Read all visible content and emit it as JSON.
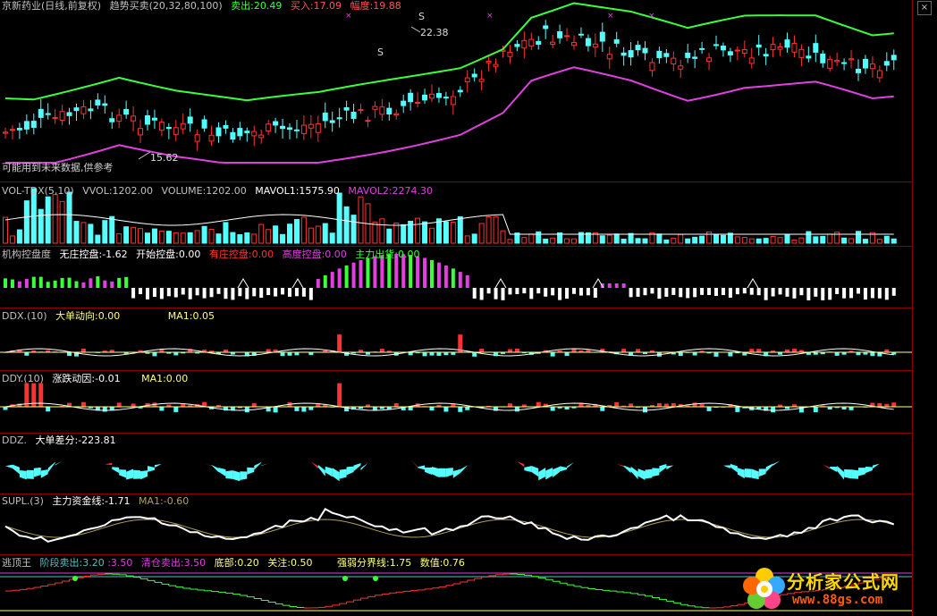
{
  "main": {
    "title": "京新药业(日线,前复权)",
    "indicator": "趋势买卖(20,32,80,100)",
    "sell_label": "卖出:20.49",
    "buy_label": "买入:17.09",
    "range_label": "幅度:19.88",
    "high_note": "22.38",
    "low_note": "15.62",
    "signal_s": "S",
    "warning": "可能用到未来数据,供参考",
    "colors": {
      "up": "#ff3232",
      "down": "#54ffff",
      "upper": "#3cff3c",
      "lower": "#e040e0"
    }
  },
  "vol": {
    "name": "VOL-TDX(5,10)",
    "vvol": "VVOL:1202.00",
    "volume": "VOLUME:1202.00",
    "mavol1": "MAVOL1:1575.90",
    "mavol2": "MAVOL2:2274.30"
  },
  "jgkpd": {
    "name": "机构控盘度",
    "a": "无庄控盘:-1.62",
    "b": "开始控盘:0.00",
    "c": "有庄控盘:0.00",
    "d": "高度控盘:0.00",
    "e": "主力出货:0.00"
  },
  "ddx": {
    "name": "DDX.(10)",
    "a": "大单动向:0.00",
    "b": "MA1:0.05"
  },
  "ddy": {
    "name": "DDY.(10)",
    "a": "涨跌动因:-0.01",
    "b": "MA1:0.00"
  },
  "ddz": {
    "name": "DDZ.",
    "a": "大单差分:-223.81"
  },
  "supl": {
    "name": "SUPL.(3)",
    "a": "主力资金线:-1.71",
    "b": "MA1:-0.60"
  },
  "tdw": {
    "name": "逃顶王",
    "a": "阶段卖出:3.20",
    "b": ":3.50",
    "c": "清仓卖出:3.50",
    "d": "底部:0.20",
    "e": "关注:0.50",
    "f": "强弱分界线:1.75",
    "g": "数值:0.76"
  },
  "logo": {
    "text": "分析家公式网",
    "url": "www.88gs.com"
  },
  "close_glyph": "×"
}
